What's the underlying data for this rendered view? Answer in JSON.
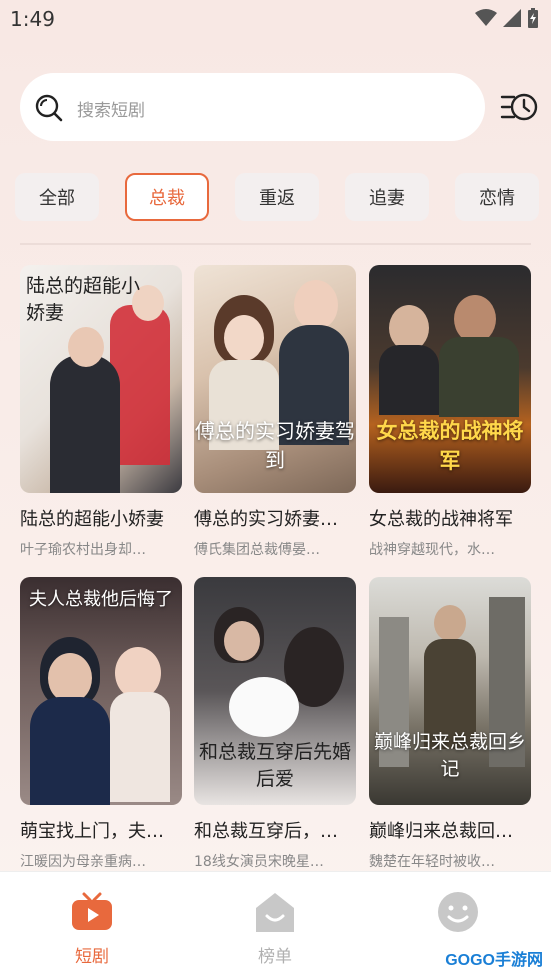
{
  "status": {
    "time": "1:49"
  },
  "search": {
    "placeholder": "搜索短剧"
  },
  "tabs": [
    {
      "label": "全部",
      "active": false
    },
    {
      "label": "总裁",
      "active": true
    },
    {
      "label": "重返",
      "active": false
    },
    {
      "label": "追妻",
      "active": false
    },
    {
      "label": "恋情",
      "active": false
    }
  ],
  "dramas": [
    {
      "title": "陆总的超能小娇妻",
      "desc": "叶子瑜农村出身却…",
      "poster_text": "陆总的超能小娇妻"
    },
    {
      "title": "傅总的实习娇妻…",
      "desc": "傅氏集团总裁傅晏…",
      "poster_text": "傅总的实习娇妻驾到"
    },
    {
      "title": "女总裁的战神将军",
      "desc": "战神穿越现代，水…",
      "poster_text": "女总裁的战神将军"
    },
    {
      "title": "萌宝找上门，夫…",
      "desc": "江暖因为母亲重病…",
      "poster_text": "夫人总裁他后悔了"
    },
    {
      "title": "和总裁互穿后，…",
      "desc": "18线女演员宋晚星…",
      "poster_text": "和总裁互穿后先婚后爱"
    },
    {
      "title": "巅峰归来总裁回…",
      "desc": "魏楚在年轻时被收…",
      "poster_text": "巅峰归来总裁回乡记"
    }
  ],
  "bottom_nav": [
    {
      "label": "短剧",
      "active": true,
      "icon": "tv-icon"
    },
    {
      "label": "榜单",
      "active": false,
      "icon": "house-icon"
    },
    {
      "label": "",
      "active": false,
      "icon": "smiley-icon"
    }
  ],
  "watermark": "GOGO手游网",
  "colors": {
    "accent": "#e8693d",
    "inactive": "#c0c0c0"
  }
}
